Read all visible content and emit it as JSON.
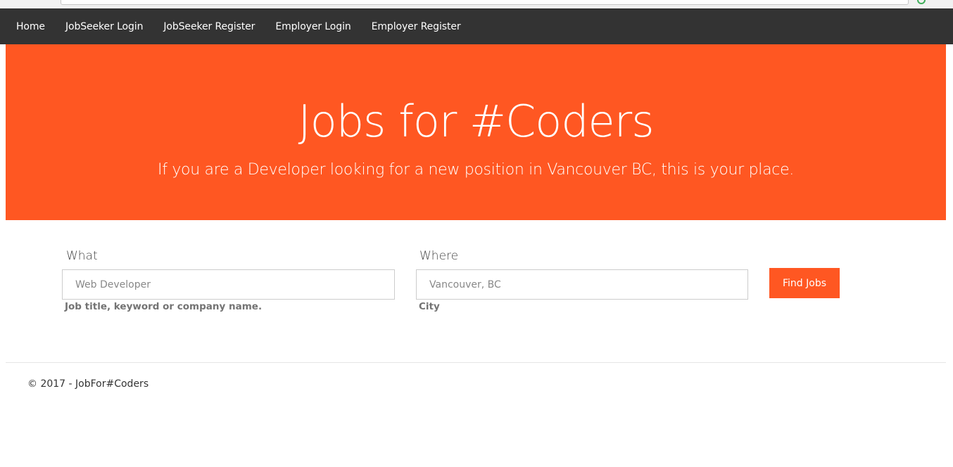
{
  "nav": {
    "items": [
      {
        "label": "Home"
      },
      {
        "label": "JobSeeker Login"
      },
      {
        "label": "JobSeeker Register"
      },
      {
        "label": "Employer Login"
      },
      {
        "label": "Employer Register"
      }
    ]
  },
  "hero": {
    "title": "Jobs for #Coders",
    "subtitle": "If you are a Developer looking for a new position in Vancouver BC, this is your place."
  },
  "search": {
    "what_label": "What",
    "what_placeholder": "Web Developer",
    "what_help": "Job title, keyword or company name.",
    "where_label": "Where",
    "where_placeholder": "Vancouver, BC",
    "where_help": "City",
    "button_label": "Find Jobs"
  },
  "footer": {
    "text": "© 2017 - JobFor#Coders"
  },
  "colors": {
    "accent": "#ff5722",
    "navbar": "#333333"
  }
}
